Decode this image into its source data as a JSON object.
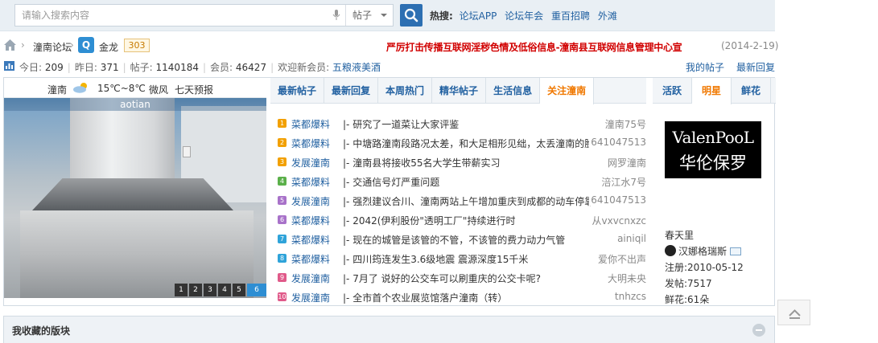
{
  "search": {
    "placeholder": "请输入搜索内容",
    "type": "帖子"
  },
  "hot": {
    "label": "热搜:",
    "keywords": [
      "论坛APP",
      "论坛年会",
      "重百招聘",
      "外滩"
    ]
  },
  "breadcrumb": {
    "sep": "›",
    "forum": "潼南论坛",
    "user_initial": "Q",
    "user": "金龙",
    "badge": "303"
  },
  "notice": {
    "text": "严厉打击传播互联网淫秽色情及低俗信息-潼南县互联网信息管理中心宣",
    "date": "(2014-2-19)"
  },
  "stats": {
    "today_label": "今日:",
    "today": "209",
    "yesterday_label": "昨日:",
    "yesterday": "371",
    "posts_label": "帖子:",
    "posts": "1140184",
    "members_label": "会员:",
    "members": "46427",
    "welcome_label": "欢迎新会员:",
    "new_member": "五粮液美酒",
    "sep": "|",
    "my_posts": "我的帖子",
    "latest_reply": "最新回复"
  },
  "weather": {
    "city": "潼南",
    "temp": "15℃~8℃",
    "wind": "微风",
    "forecast": "七天预报"
  },
  "slideshow": {
    "caption": "aotian",
    "pages": [
      "1",
      "2",
      "3",
      "4",
      "5",
      "6"
    ],
    "active": "6"
  },
  "tabs": [
    "最新帖子",
    "最新回复",
    "本周热门",
    "精华帖子",
    "生活信息",
    "关注潼南"
  ],
  "active_tab": "关注潼南",
  "posts": [
    {
      "n": "1",
      "cat": "菜都爆料",
      "title": "|- 研究了一道菜让大家评鉴",
      "author": "潼南75号",
      "color": "#f2a000"
    },
    {
      "n": "2",
      "cat": "菜都爆料",
      "title": "|- 中塘路潼南段路况太差，和大足相形见绌，太丢潼南的脸面",
      "author": "641047513",
      "color": "#f2a000"
    },
    {
      "n": "3",
      "cat": "发展潼南",
      "title": "|- 潼南县将接收55名大学生带薪实习",
      "author": "网罗潼南",
      "color": "#f2a000"
    },
    {
      "n": "4",
      "cat": "菜都爆料",
      "title": "|- 交通信号灯严重问题",
      "author": "涪江水7号",
      "color": "#5bb04a"
    },
    {
      "n": "5",
      "cat": "发展潼南",
      "title": "|- 强烈建议合川、潼南两站上午增加重庆到成都的动车停靠",
      "author": "641047513",
      "color": "#a872c9"
    },
    {
      "n": "6",
      "cat": "菜都爆料",
      "title": "|- 2042(伊利股份\"透明工厂\"持续进行时",
      "author": "从vxvcnxzc",
      "color": "#a872c9"
    },
    {
      "n": "7",
      "cat": "菜都爆料",
      "title": "|- 现在的城管是该管的不管，不该管的费力动力气管",
      "author": "ainiqil",
      "color": "#2fa3d9"
    },
    {
      "n": "8",
      "cat": "菜都爆料",
      "title": "|- 四川筠连发生3.6级地震 震源深度15千米",
      "author": "爱你不出声",
      "color": "#2fa3d9"
    },
    {
      "n": "9",
      "cat": "发展潼南",
      "title": "|- 7月了 说好的公交车可以刷重庆的公交卡呢?",
      "author": "大明未央",
      "color": "#e05a8a"
    },
    {
      "n": "10",
      "cat": "发展潼南",
      "title": "|- 全市首个农业展览馆落户潼南（转）",
      "author": "tnhzcs",
      "color": "#e05a8a"
    }
  ],
  "right_tabs": [
    "活跃",
    "明星",
    "鲜花"
  ],
  "right_active": "明星",
  "star": {
    "img_en": "ValenPooL",
    "img_cn": "华伦保罗",
    "name": "春天里",
    "qq_name": "汉娜格瑞斯",
    "reg": "注册:2010-05-12",
    "posts": "发帖:7517",
    "flowers": "鲜花:61朵"
  },
  "favorites": {
    "title": "我收藏的版块"
  },
  "colors": {
    "accent": "#2261a1",
    "active_tab": "#f07800",
    "notice": "#d10000",
    "search_button": "#2d6fb2"
  }
}
